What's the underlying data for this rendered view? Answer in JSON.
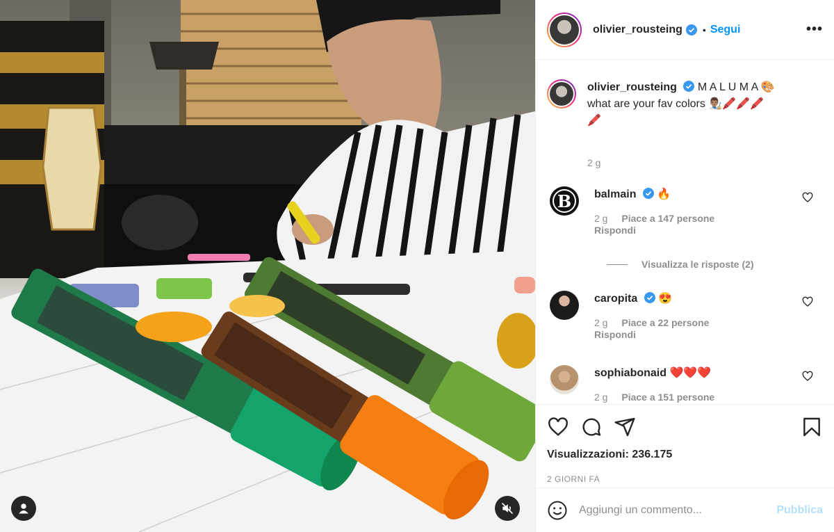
{
  "post": {
    "username": "olivier_rousteing",
    "follow_label": "Segui",
    "separator": "•",
    "more_label": "•••"
  },
  "caption": {
    "username": "olivier_rousteing",
    "text_line1": "M A L U M A 🎨",
    "text_line2": "what are your fav colors 👨🏽‍🎨🖍️🖍️🖍️",
    "text_line3": "🖍️",
    "time": "2 g"
  },
  "comments": [
    {
      "username": "balmain",
      "text": "🔥",
      "time": "2 g",
      "likes": "Piace a 147 persone",
      "reply_label": "Rispondi",
      "view_replies": "Visualizza le risposte (2)"
    },
    {
      "username": "caropita",
      "text": "😍",
      "time": "2 g",
      "likes": "Piace a 22 persone",
      "reply_label": "Rispondi"
    },
    {
      "username": "sophiabonaid",
      "text": "❤️❤️❤️",
      "time": "2 g",
      "likes": "Piace a 151 persone"
    }
  ],
  "stats": {
    "views": "Visualizzazioni: 236.175",
    "ago": "2 GIORNI FA"
  },
  "composer": {
    "placeholder": "Aggiungi un commento...",
    "publish_label": "Pubblica"
  },
  "colors": {
    "accent": "#0095f6",
    "publish_disabled": "#b2dffc",
    "muted": "#8e8e8e"
  },
  "icons": [
    "user-tag-icon",
    "mute-icon",
    "verified-icon",
    "more-icon",
    "heart-icon",
    "comment-icon",
    "share-icon",
    "bookmark-icon",
    "emoji-icon"
  ]
}
